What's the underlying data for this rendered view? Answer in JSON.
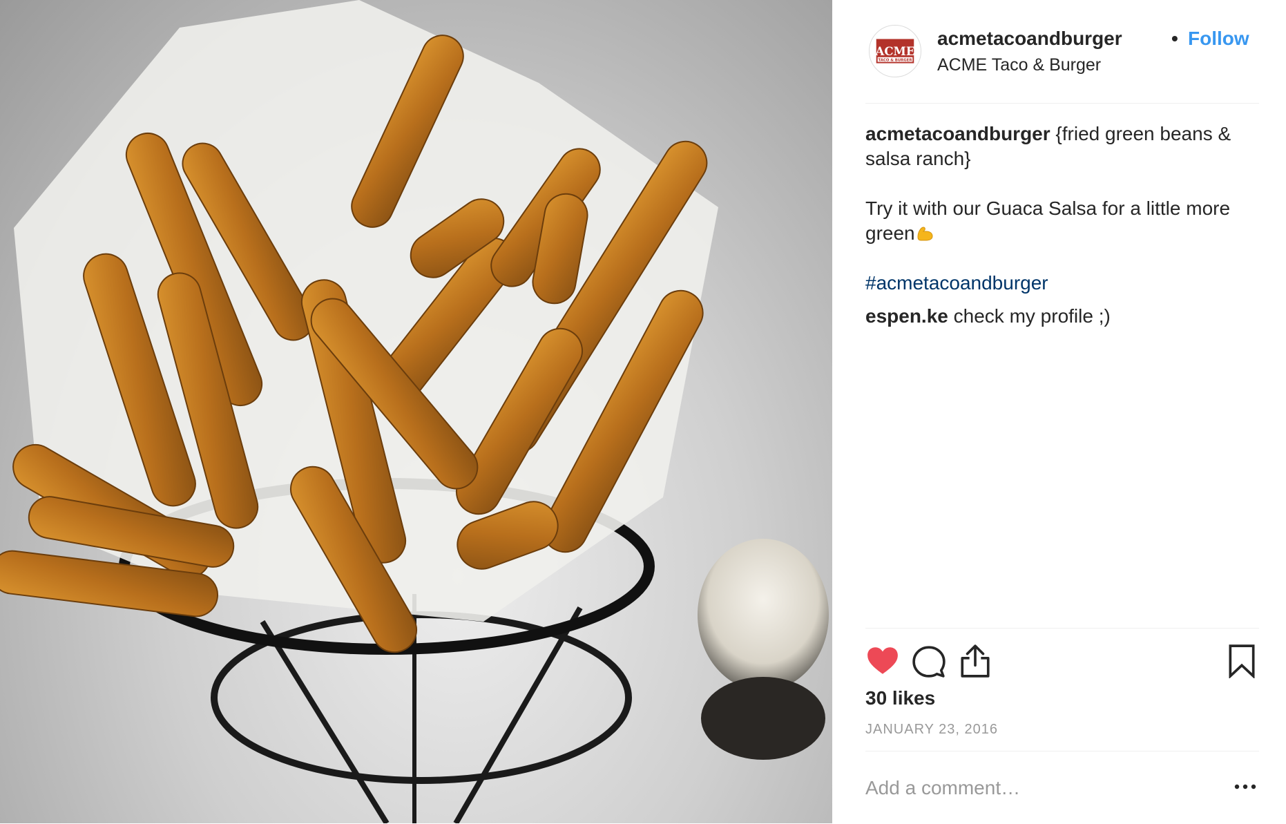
{
  "post": {
    "username": "acmetacoandburger",
    "separator": "•",
    "follow_label": "Follow",
    "location": "ACME Taco & Burger",
    "avatar_text_top": "ACME",
    "avatar_text_bottom": "TACO & BURGER",
    "caption": {
      "username": "acmetacoandburger",
      "line1": " {fried green beans & salsa ranch}",
      "line2": "Try it with our Guaca Salsa for a little more green",
      "hashtag": "#acmetacoandburger"
    },
    "comment": {
      "username": "espen.ke",
      "text": " check my profile ;)"
    },
    "likes": "30 likes",
    "date": "January 23, 2016",
    "comment_placeholder": "Add a comment…",
    "icons": {
      "like": "heart-filled-icon",
      "comment": "speech-bubble-icon",
      "share": "share-upload-icon",
      "save": "bookmark-icon",
      "more": "ellipsis-icon",
      "emoji": "flexed-biceps-emoji"
    },
    "colors": {
      "like_red": "#ed4956",
      "follow_blue": "#3897f0",
      "hashtag_blue": "#003569",
      "muted_gray": "#999999",
      "brand_red": "#b3322a"
    }
  }
}
